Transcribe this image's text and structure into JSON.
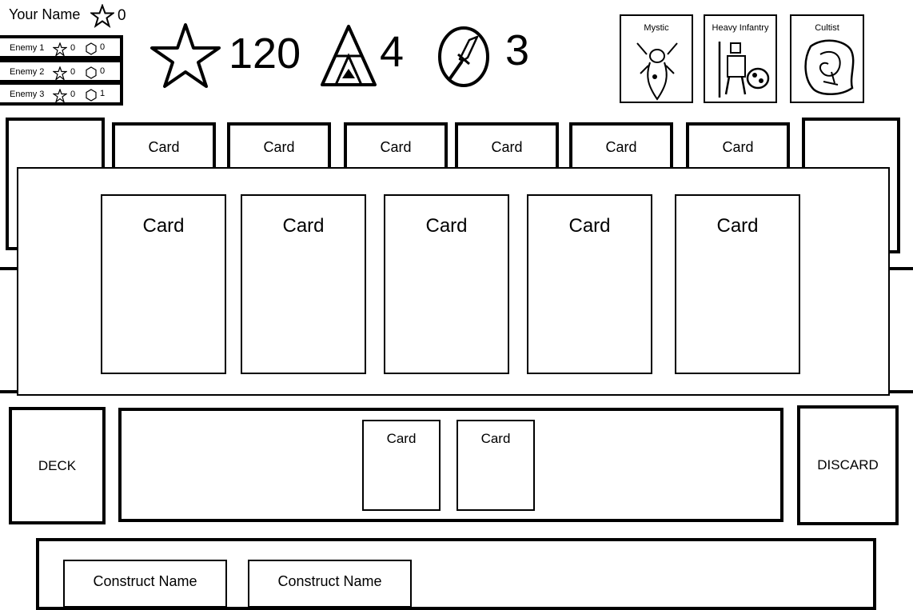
{
  "player": {
    "name": "Your Name",
    "score": "0"
  },
  "enemies": [
    {
      "name": "Enemy 1",
      "stars": "0",
      "hexes": "0"
    },
    {
      "name": "Enemy 2",
      "stars": "0",
      "hexes": "0"
    },
    {
      "name": "Enemy 3",
      "stars": "0",
      "hexes": "1"
    }
  ],
  "stats": {
    "honor": "120",
    "runes": "4",
    "power": "3"
  },
  "factions": [
    "Mystic",
    "Heavy Infantry",
    "Cultist"
  ],
  "center_row": {
    "cards": [
      "Card",
      "Card",
      "Card",
      "Card",
      "Card",
      "Card"
    ]
  },
  "hand_overlay": {
    "cards": [
      "Card",
      "Card",
      "Card",
      "Card",
      "Card"
    ]
  },
  "deck": {
    "label": "DECK"
  },
  "played": {
    "cards": [
      "Card",
      "Card"
    ]
  },
  "discard": {
    "label": "DISCARD"
  },
  "constructs": [
    "Construct Name",
    "Construct Name"
  ],
  "icons": {
    "player_score": "star-icon",
    "enemy_stars": "star-icon",
    "enemy_hexes": "hexagon-icon",
    "honor": "star-icon",
    "runes": "triforce-icon",
    "power": "sword-icon"
  }
}
